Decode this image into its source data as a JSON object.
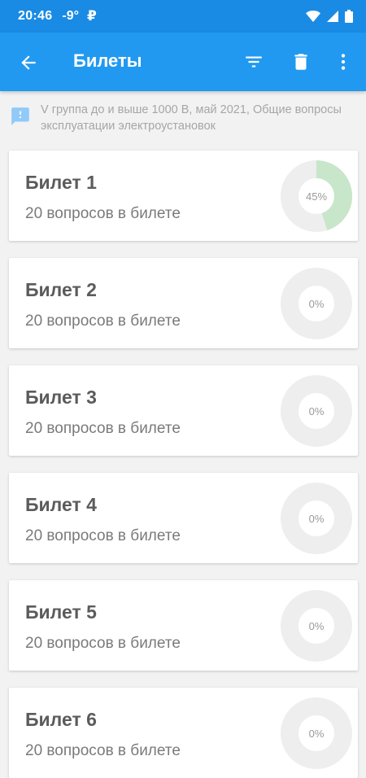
{
  "status_bar": {
    "time": "20:46",
    "temperature": "-9°",
    "payment_indicator": "₽",
    "icons": [
      "wifi-icon",
      "signal-icon",
      "battery-icon"
    ]
  },
  "app_bar": {
    "title": "Билеты",
    "back_icon": "arrow-left-icon",
    "actions": [
      "filter-icon",
      "delete-icon",
      "more-vert-icon"
    ],
    "background": "#2199f0"
  },
  "info": {
    "icon": "feedback-icon",
    "text": "V группа до и выше 1000 В, май 2021, Общие вопросы эксплуатации электроустановок"
  },
  "colors": {
    "accent": "#2199f0",
    "progress": "#c8e6c9",
    "ring_track": "#eeeeee"
  },
  "tickets": [
    {
      "name": "Билет 1",
      "subtitle": "20 вопросов в билете",
      "progress_label": "45%",
      "progress": 0.45
    },
    {
      "name": "Билет 2",
      "subtitle": "20 вопросов в билете",
      "progress_label": "0%",
      "progress": 0
    },
    {
      "name": "Билет 3",
      "subtitle": "20 вопросов в билете",
      "progress_label": "0%",
      "progress": 0
    },
    {
      "name": "Билет 4",
      "subtitle": "20 вопросов в билете",
      "progress_label": "0%",
      "progress": 0
    },
    {
      "name": "Билет 5",
      "subtitle": "20 вопросов в билете",
      "progress_label": "0%",
      "progress": 0
    },
    {
      "name": "Билет 6",
      "subtitle": "20 вопросов в билете",
      "progress_label": "0%",
      "progress": 0
    }
  ]
}
